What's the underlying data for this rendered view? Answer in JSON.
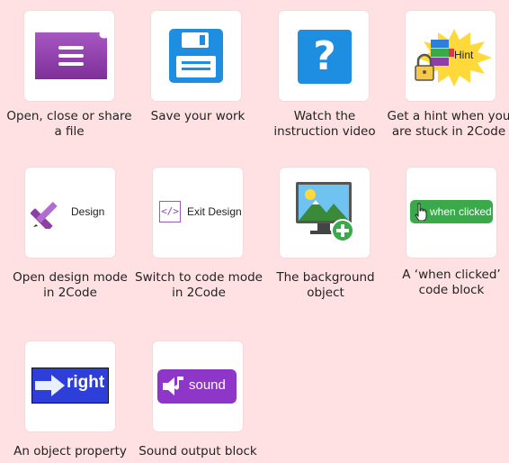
{
  "colors": {
    "background": "#ffe1e4",
    "card": "#ffffff",
    "file_purple": "#8e3fa6",
    "save_blue": "#1e8fe0",
    "help_blue": "#1e8fe0",
    "when_clicked_green": "#3aa94a",
    "right_block_blue": "#2d3fd8",
    "sound_purple": "#8e36c7"
  },
  "tiles": [
    {
      "icon": "file-menu-icon",
      "caption_lines": [
        "Open, close or share",
        "a file"
      ]
    },
    {
      "icon": "floppy-disk-icon",
      "caption_lines": [
        "Save your work"
      ]
    },
    {
      "icon": "question-mark-icon",
      "caption_lines": [
        "Watch the",
        "instruction video"
      ]
    },
    {
      "icon": "hint-icon",
      "label": "Hint",
      "caption_lines": [
        "Get a hint when you",
        "are stuck in 2Code"
      ]
    },
    {
      "icon": "pencil-ruler-icon",
      "label": "Design",
      "caption_lines": [
        "Open design mode",
        "in 2Code"
      ]
    },
    {
      "icon": "code-brackets-icon",
      "glyph": "</>",
      "label": "Exit Design",
      "caption_lines": [
        "Switch to code mode",
        "in 2Code"
      ]
    },
    {
      "icon": "background-image-icon",
      "caption_lines": [
        "The background",
        "object"
      ]
    },
    {
      "icon": "hand-pointer-icon",
      "label": "when clicked",
      "caption_lines": [
        "A ‘when clicked’",
        "code block"
      ]
    },
    {
      "icon": "arrow-right-icon",
      "label": "right",
      "caption_lines": [
        "An  object property"
      ]
    },
    {
      "icon": "speaker-note-icon",
      "label": "sound",
      "caption_lines": [
        "Sound output block"
      ]
    }
  ]
}
